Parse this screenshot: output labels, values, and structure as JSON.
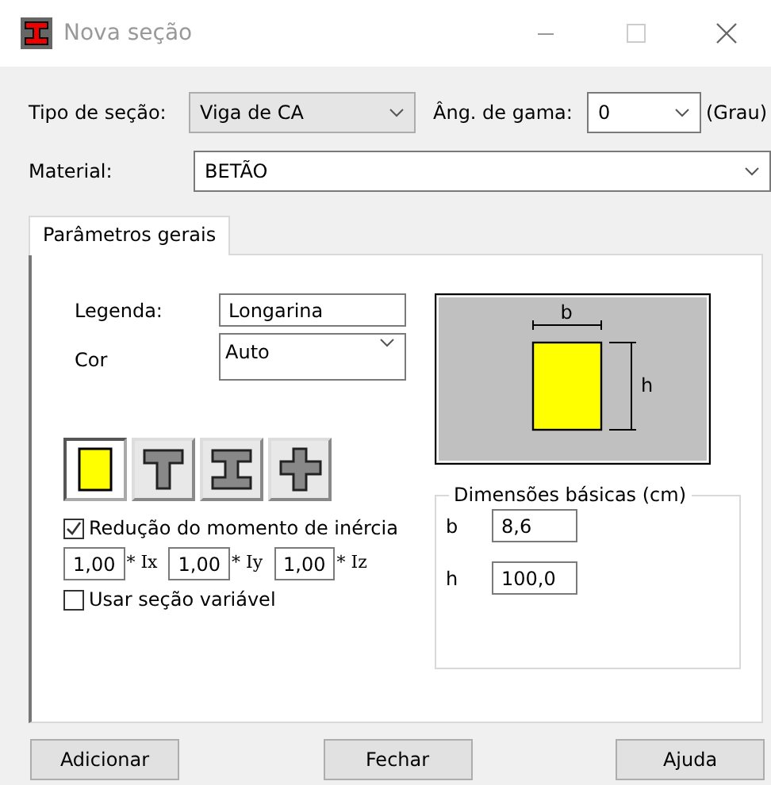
{
  "window": {
    "title": "Nova seção"
  },
  "section_type": {
    "label": "Tipo de seção:",
    "value": "Viga de CA"
  },
  "gamma_angle": {
    "label": "Âng. de gama:",
    "value": "0",
    "unit": "(Grau)"
  },
  "material": {
    "label": "Material:",
    "value": "BETÃO"
  },
  "tabs": [
    {
      "label": "Parâmetros gerais",
      "selected": true
    }
  ],
  "legend": {
    "label": "Legenda:",
    "value": "Longarina"
  },
  "color": {
    "label": "Cor",
    "value": "Auto"
  },
  "shapes": [
    {
      "kind": "rect",
      "selected": true
    },
    {
      "kind": "tee",
      "selected": false
    },
    {
      "kind": "ibeam",
      "selected": false
    },
    {
      "kind": "cross",
      "selected": false
    }
  ],
  "inertia_reduction": {
    "label": "Redução do momento de inércia",
    "checked": true
  },
  "factors": [
    {
      "value": "1,00",
      "suffix": "* Ix"
    },
    {
      "value": "1,00",
      "suffix": "* Iy"
    },
    {
      "value": "1,00",
      "suffix": "* Iz"
    }
  ],
  "variable_section": {
    "label": "Usar seção variável",
    "checked": false
  },
  "preview": {
    "width_label": "b",
    "height_label": "h"
  },
  "dimensions": {
    "title": "Dimensões básicas (cm)",
    "fields": [
      {
        "label": "b",
        "value": "8,6"
      },
      {
        "label": "h",
        "value": "100,0"
      }
    ]
  },
  "buttons": [
    "Adicionar",
    "Fechar",
    "Ajuda"
  ]
}
